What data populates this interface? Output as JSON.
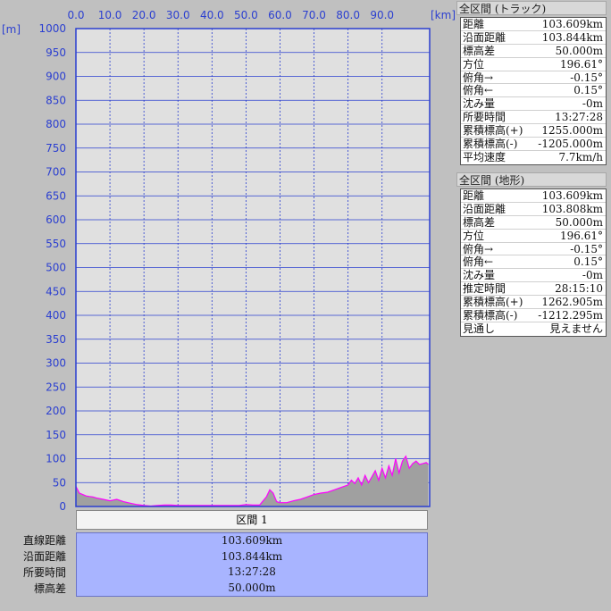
{
  "chart_data": {
    "type": "area",
    "x_unit": "[km]",
    "y_unit": "[m]",
    "xlim": [
      0,
      104
    ],
    "ylim": [
      0,
      1000
    ],
    "x_ticks": [
      "0.0",
      "10.0",
      "20.0",
      "30.0",
      "40.0",
      "50.0",
      "60.0",
      "70.0",
      "80.0",
      "90.0"
    ],
    "y_ticks": [
      "1000",
      "950",
      "900",
      "850",
      "800",
      "750",
      "700",
      "650",
      "600",
      "550",
      "500",
      "450",
      "400",
      "350",
      "300",
      "250",
      "200",
      "150",
      "100",
      "50",
      "0"
    ],
    "fill_color": "#a0a0a0",
    "line_color": "#ff00ff",
    "grid": true,
    "series": [
      {
        "x": [
          0,
          1,
          2,
          3,
          4,
          5,
          6,
          8,
          10,
          12,
          14,
          16,
          18,
          20,
          22,
          24,
          26,
          28,
          30,
          34,
          38,
          42,
          46,
          48,
          50,
          52,
          54,
          56,
          57,
          58,
          59,
          60,
          62,
          64,
          66,
          68,
          70,
          72,
          74,
          76,
          78,
          80,
          81,
          82,
          83,
          84,
          85,
          86,
          87,
          88,
          89,
          90,
          91,
          92,
          93,
          94,
          95,
          96,
          97,
          98,
          99,
          100,
          101,
          102,
          103,
          103.6
        ],
        "y": [
          42,
          28,
          25,
          22,
          21,
          20,
          18,
          15,
          12,
          15,
          10,
          7,
          4,
          2,
          1,
          2,
          3,
          3,
          2,
          2,
          2,
          2,
          2,
          2,
          4,
          3,
          3,
          20,
          35,
          28,
          10,
          8,
          8,
          12,
          15,
          20,
          25,
          28,
          30,
          35,
          40,
          45,
          55,
          48,
          60,
          45,
          65,
          50,
          62,
          75,
          55,
          80,
          60,
          85,
          65,
          100,
          70,
          95,
          105,
          80,
          90,
          95,
          88,
          90,
          92,
          88
        ]
      }
    ]
  },
  "summary_track": {
    "title": "全区間 (トラック)",
    "rows": [
      {
        "label": "距離",
        "value": "103.609km"
      },
      {
        "label": "沿面距離",
        "value": "103.844km"
      },
      {
        "label": "標高差",
        "value": "50.000m"
      },
      {
        "label": "方位",
        "value": "196.61°"
      },
      {
        "label": "俯角→",
        "value": "-0.15°"
      },
      {
        "label": "俯角←",
        "value": "0.15°"
      },
      {
        "label": "沈み量",
        "value": "-0m"
      },
      {
        "label": "所要時間",
        "value": "13:27:28"
      },
      {
        "label": "累積標高(+)",
        "value": "1255.000m"
      },
      {
        "label": "累積標高(-)",
        "value": "-1205.000m"
      },
      {
        "label": "平均速度",
        "value": "7.7km/h"
      }
    ]
  },
  "summary_terrain": {
    "title": "全区間 (地形)",
    "rows": [
      {
        "label": "距離",
        "value": "103.609km"
      },
      {
        "label": "沿面距離",
        "value": "103.808km"
      },
      {
        "label": "標高差",
        "value": "50.000m"
      },
      {
        "label": "方位",
        "value": "196.61°"
      },
      {
        "label": "俯角→",
        "value": "-0.15°"
      },
      {
        "label": "俯角←",
        "value": "0.15°"
      },
      {
        "label": "沈み量",
        "value": "-0m"
      },
      {
        "label": "推定時間",
        "value": "28:15:10"
      },
      {
        "label": "累積標高(+)",
        "value": "1262.905m"
      },
      {
        "label": "累積標高(-)",
        "value": "-1212.295m"
      },
      {
        "label": "見通し",
        "value": "見えません"
      }
    ]
  },
  "segment": {
    "button_label": "区間 1",
    "labels": [
      "直線距離",
      "沿面距離",
      "所要時間",
      "標高差"
    ],
    "values": [
      "103.609km",
      "103.844km",
      "13:27:28",
      "50.000m"
    ]
  }
}
